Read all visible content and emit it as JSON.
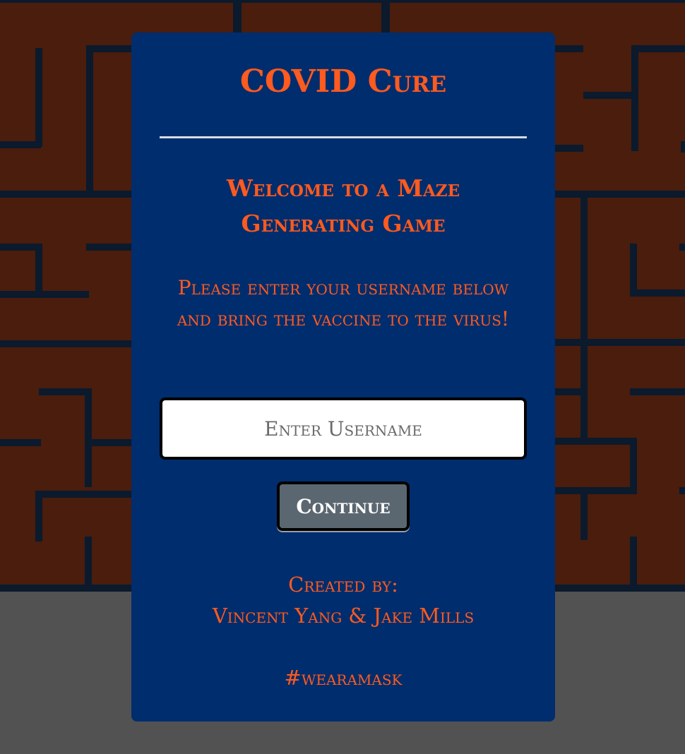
{
  "colors": {
    "maze_background": "#4a1d0d",
    "maze_walls": "#0b1a2c",
    "page_background": "#525252",
    "modal_background": "#002d6d",
    "accent_text": "#ff5a1f",
    "button_background": "#5b6770"
  },
  "modal": {
    "title": "COVID Cure",
    "welcome": "Welcome to a Maze Generating Game",
    "instructions": "Please enter your username below and bring the vaccine to the virus!",
    "username_placeholder": "Enter Username",
    "username_value": "",
    "continue_label": "Continue",
    "credits_label": "Created by:",
    "credits_names": "Vincent Yang & Jake Mills",
    "hashtag": "#wearamask"
  }
}
